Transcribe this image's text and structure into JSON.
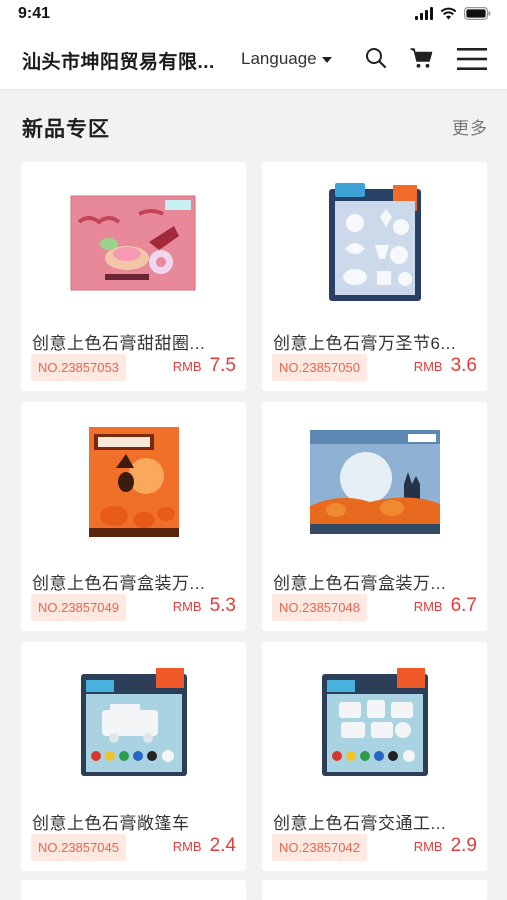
{
  "status": {
    "time": "9:41"
  },
  "header": {
    "company": "汕头市坤阳贸易有限...",
    "language": "Language"
  },
  "section": {
    "title": "新品专区",
    "more": "更多"
  },
  "products": [
    {
      "title": "创意上色石膏甜甜圈...",
      "code": "NO.23857053",
      "currency": "RMB",
      "price": "7.5"
    },
    {
      "title": "创意上色石膏万圣节6...",
      "code": "NO.23857050",
      "currency": "RMB",
      "price": "3.6"
    },
    {
      "title": "创意上色石膏盒装万...",
      "code": "NO.23857049",
      "currency": "RMB",
      "price": "5.3"
    },
    {
      "title": "创意上色石膏盒装万...",
      "code": "NO.23857048",
      "currency": "RMB",
      "price": "6.7"
    },
    {
      "title": "创意上色石膏敞篷车",
      "code": "NO.23857045",
      "currency": "RMB",
      "price": "2.4"
    },
    {
      "title": "创意上色石膏交通工...",
      "code": "NO.23857042",
      "currency": "RMB",
      "price": "2.9"
    }
  ],
  "colors": {
    "price": "#e23b3b",
    "code_text": "#e8664a",
    "code_bg": "#fde8e2",
    "page_bg": "#f2f2f2"
  },
  "icons": [
    "signal-icon",
    "wifi-icon",
    "battery-icon",
    "caret-down-icon",
    "search-icon",
    "cart-icon",
    "menu-icon"
  ]
}
